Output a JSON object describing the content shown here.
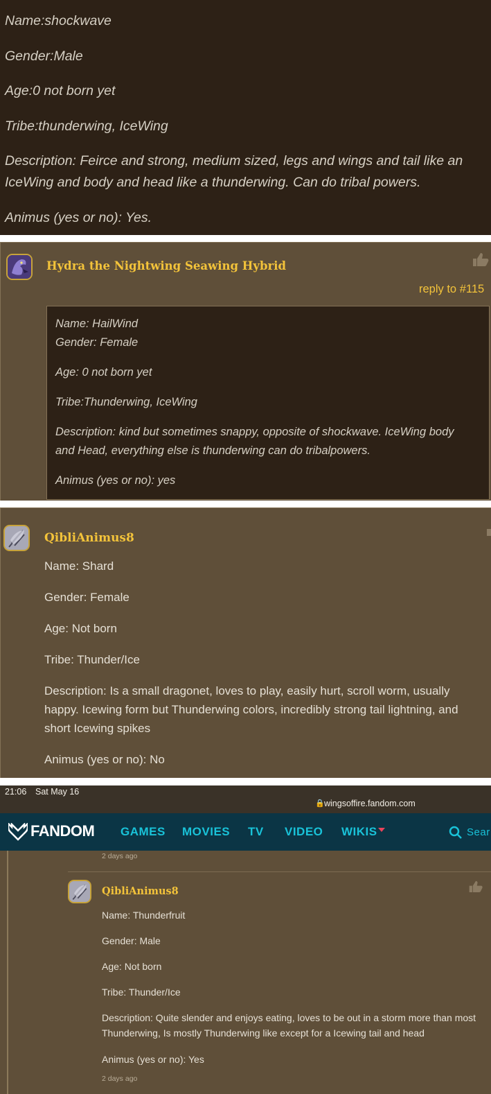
{
  "panel1": {
    "name": "Name:shockwave",
    "gender": "Gender:Male",
    "age": "Age:0 not born yet",
    "tribe": "Tribe:thunderwing, IceWing",
    "description": "Description: Feirce and strong, medium sized, legs and wings and tail like an IceWing and body and head like a thunderwing. Can do tribal powers.",
    "animus": "Animus (yes or no): Yes."
  },
  "panel2": {
    "username": "Hydra the Nightwing Seawing Hybrid",
    "reply_to": "reply to #115",
    "quote": {
      "name": "Name: HailWind",
      "gender": "Gender: Female",
      "age": "Age: 0 not born yet",
      "tribe": "Tribe:Thunderwing, IceWing",
      "description": "Description: kind but sometimes snappy, opposite of shockwave. IceWing body and Head, everything else is thunderwing can do tribalpowers.",
      "animus": "Animus (yes or no): yes"
    }
  },
  "panel3": {
    "username": "QibliAnimus8",
    "name": "Name: Shard",
    "gender": "Gender: Female",
    "age": "Age: Not born",
    "tribe": "Tribe: Thunder/Ice",
    "description": "Description: Is a small dragonet, loves to play, easily hurt, scroll worm, usually happy. Icewing form but Thunderwing colors, incredibly strong tail lightning, and short Icewing spikes",
    "animus": "Animus (yes or no): No"
  },
  "panel4": {
    "status_time": "21:06",
    "status_date": "Sat May 16",
    "url": "wingsoffire.fandom.com",
    "nav": {
      "logo": "FANDOM",
      "games": "GAMES",
      "movies": "MOVIES",
      "tv": "TV",
      "video": "VIDEO",
      "wikis": "WIKIS",
      "search": "Sear"
    },
    "prev_time": "2 days ago",
    "comment": {
      "username": "QibliAnimus8",
      "name": "Name: Thunderfruit",
      "gender": "Gender: Male",
      "age": "Age: Not born",
      "tribe": "Tribe: Thunder/Ice",
      "description": "Description: Quite slender and enjoys eating, loves to be out in a storm more than most Thunderwing, Is mostly Thunderwing like except for a Icewing tail and head",
      "animus": "Animus (yes or no): Yes",
      "time": "2 days ago"
    }
  },
  "colors": {
    "dark_bg": "#2d2116",
    "comment_bg": "#5f4f39",
    "username": "#f3c33a",
    "nav_bg": "#0b3545",
    "nav_text": "#19c2d8"
  }
}
